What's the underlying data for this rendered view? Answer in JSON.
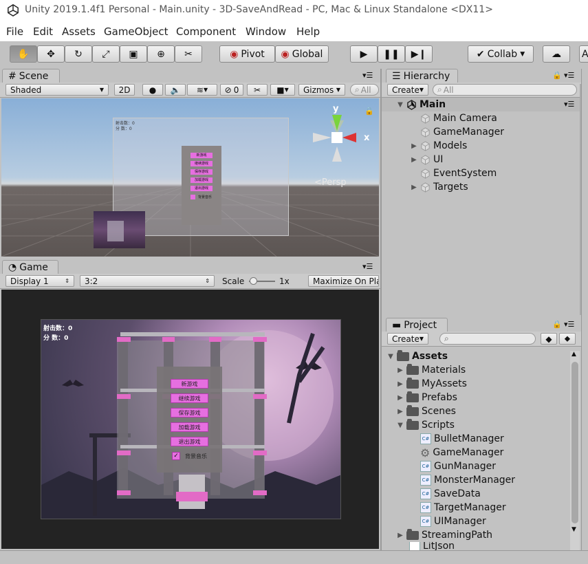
{
  "window": {
    "title": "Unity 2019.1.4f1 Personal - Main.unity - 3D-SaveAndRead - PC, Mac & Linux Standalone <DX11>"
  },
  "menu": [
    "File",
    "Edit",
    "Assets",
    "GameObject",
    "Component",
    "Window",
    "Help"
  ],
  "toolbar": {
    "pivot": "Pivot",
    "global": "Global",
    "collab": "Collab",
    "account": "A"
  },
  "scene": {
    "tab": "Scene",
    "shading": "Shaded",
    "mode_2d": "2D",
    "hidden_count": "0",
    "gizmos": "Gizmos",
    "search_placeholder": "All",
    "axis_y": "y",
    "axis_x": "x",
    "persp": "Persp",
    "overlay_hits": "射击数：0",
    "overlay_score": "分  数：0",
    "menu_buttons": [
      "新游戏",
      "继续游戏",
      "保存游戏",
      "加载游戏",
      "退出游戏"
    ],
    "music_label": "背景音乐"
  },
  "game": {
    "tab": "Game",
    "display": "Display 1",
    "aspect": "3:2",
    "scale_label": "Scale",
    "scale_value": "1x",
    "maximize": "Maximize On Play",
    "hits_label": "射击数：0",
    "score_label": "分   数：0",
    "menu_buttons": [
      "新游戏",
      "继续游戏",
      "保存游戏",
      "加载游戏",
      "退出游戏"
    ],
    "music_label": "背景音乐",
    "scale_level": 0.15
  },
  "hierarchy": {
    "tab": "Hierarchy",
    "create": "Create",
    "search_placeholder": "All",
    "scene_name": "Main",
    "items": [
      {
        "label": "Main Camera",
        "expandable": false
      },
      {
        "label": "GameManager",
        "expandable": false
      },
      {
        "label": "Models",
        "expandable": true
      },
      {
        "label": "UI",
        "expandable": true
      },
      {
        "label": "EventSystem",
        "expandable": false
      },
      {
        "label": "Targets",
        "expandable": true
      }
    ]
  },
  "project": {
    "tab": "Project",
    "create": "Create",
    "root": "Assets",
    "folders": [
      "Materials",
      "MyAssets",
      "Prefabs",
      "Scenes"
    ],
    "scripts_folder": "Scripts",
    "scripts": [
      {
        "label": "BulletManager",
        "icon": "cs-script-icon"
      },
      {
        "label": "GameManager",
        "icon": "gear-icon"
      },
      {
        "label": "GunManager",
        "icon": "cs-script-icon"
      },
      {
        "label": "MonsterManager",
        "icon": "cs-script-icon"
      },
      {
        "label": "SaveData",
        "icon": "cs-script-icon"
      },
      {
        "label": "TargetManager",
        "icon": "cs-script-icon"
      },
      {
        "label": "UIManager",
        "icon": "cs-script-icon"
      }
    ],
    "after": "StreamingPath",
    "cut_off": "LitJson"
  },
  "colors": {
    "accent_pink": "#e66fe0",
    "scene_sky": "#8ab0d8",
    "scene_ground": "#6b6563",
    "game_bg": "#232323"
  }
}
